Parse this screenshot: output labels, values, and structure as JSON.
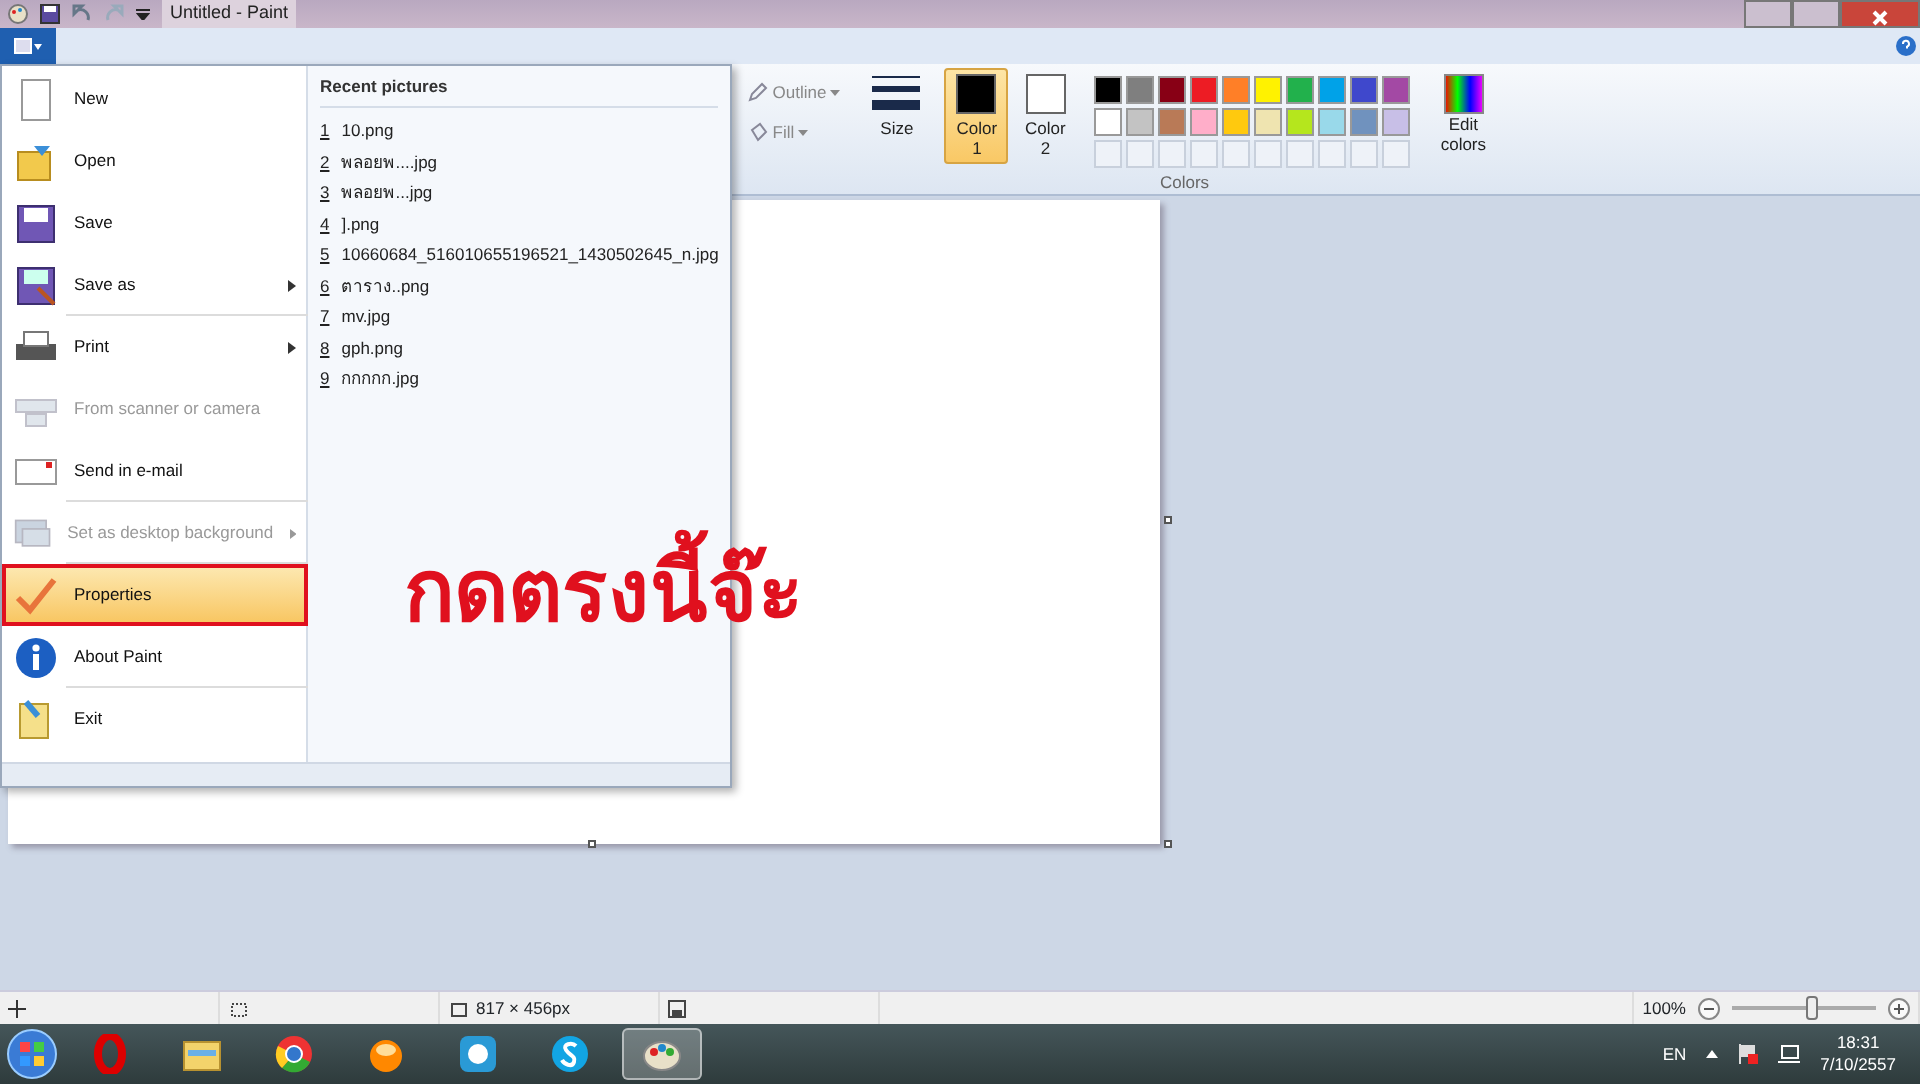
{
  "window": {
    "title": "Untitled - Paint"
  },
  "ribbon": {
    "outline_label": "Outline",
    "fill_label": "Fill",
    "size_label": "Size",
    "color_slots": [
      {
        "label": "Color 1",
        "selected": true,
        "color": "#000000"
      },
      {
        "label": "Color 2",
        "selected": false,
        "color": "#ffffff"
      }
    ],
    "palette": [
      {
        "color": "#000000"
      },
      {
        "color": "#7f7f7f"
      },
      {
        "color": "#880015"
      },
      {
        "color": "#ed1c24"
      },
      {
        "color": "#ff7f27"
      },
      {
        "color": "#fff200"
      },
      {
        "color": "#22b14c"
      },
      {
        "color": "#00a2e8"
      },
      {
        "color": "#3f48cc"
      },
      {
        "color": "#a349a4"
      },
      {
        "color": "#ffffff"
      },
      {
        "color": "#c3c3c3"
      },
      {
        "color": "#b97a57"
      },
      {
        "color": "#ffaec9"
      },
      {
        "color": "#ffc90e"
      },
      {
        "color": "#efe4b0"
      },
      {
        "color": "#b5e61d"
      },
      {
        "color": "#99d9ea"
      },
      {
        "color": "#7092be"
      },
      {
        "color": "#c8bfe7"
      }
    ],
    "edit_colors_label": "Edit colors",
    "group_label": "Colors"
  },
  "file_menu": {
    "items": [
      {
        "kind": "new",
        "label": "New",
        "disabled": false,
        "submenu": false,
        "highlighted": false,
        "separator_after": false
      },
      {
        "kind": "open",
        "label": "Open",
        "disabled": false,
        "submenu": false,
        "highlighted": false,
        "separator_after": false
      },
      {
        "kind": "save",
        "label": "Save",
        "disabled": false,
        "submenu": false,
        "highlighted": false,
        "separator_after": false
      },
      {
        "kind": "saveas",
        "label": "Save as",
        "disabled": false,
        "submenu": true,
        "highlighted": false,
        "separator_after": true
      },
      {
        "kind": "print",
        "label": "Print",
        "disabled": false,
        "submenu": true,
        "highlighted": false,
        "separator_after": false
      },
      {
        "kind": "scanner",
        "label": "From scanner or camera",
        "disabled": true,
        "submenu": false,
        "highlighted": false,
        "separator_after": false
      },
      {
        "kind": "email",
        "label": "Send in e-mail",
        "disabled": false,
        "submenu": false,
        "highlighted": false,
        "separator_after": true
      },
      {
        "kind": "desktop",
        "label": "Set as desktop background",
        "disabled": true,
        "submenu": true,
        "highlighted": false,
        "separator_after": true
      },
      {
        "kind": "properties",
        "label": "Properties",
        "disabled": false,
        "submenu": false,
        "highlighted": true,
        "separator_after": false
      },
      {
        "kind": "about",
        "label": "About Paint",
        "disabled": false,
        "submenu": false,
        "highlighted": false,
        "separator_after": true
      },
      {
        "kind": "exit",
        "label": "Exit",
        "disabled": false,
        "submenu": false,
        "highlighted": false,
        "separator_after": false
      }
    ],
    "recent_title": "Recent pictures",
    "recent": [
      {
        "number": "1",
        "name": "10.png"
      },
      {
        "number": "2",
        "name": "พลอยพ....jpg"
      },
      {
        "number": "3",
        "name": "พลอยพ...jpg"
      },
      {
        "number": "4",
        "name": "].png"
      },
      {
        "number": "5",
        "name": "10660684_516010655196521_1430502645_n.jpg"
      },
      {
        "number": "6",
        "name": "ตาราง..png"
      },
      {
        "number": "7",
        "name": "mv.jpg"
      },
      {
        "number": "8",
        "name": "gph.png"
      },
      {
        "number": "9",
        "name": "กกกกก.jpg"
      }
    ]
  },
  "annotation": {
    "text": "กดตรงนี้จ๊ะ"
  },
  "status_bar": {
    "image_size": "817 × 456px",
    "zoom": "100%",
    "zoom_level": {
      "level": 0.55
    }
  },
  "taskbar": {
    "apps": [
      {
        "kind": "opera",
        "active": false
      },
      {
        "kind": "explorer",
        "active": false
      },
      {
        "kind": "chrome",
        "active": false
      },
      {
        "kind": "player",
        "active": false
      },
      {
        "kind": "elephant",
        "active": false
      },
      {
        "kind": "skype",
        "active": false
      },
      {
        "kind": "paint",
        "active": true
      }
    ],
    "language": "EN",
    "time": "18:31",
    "date": "7/10/2557"
  }
}
